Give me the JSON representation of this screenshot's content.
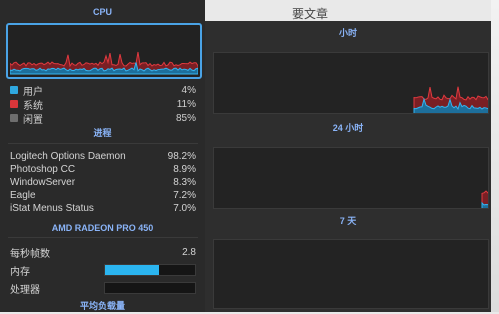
{
  "background": {
    "partial_text": "要文章"
  },
  "left_panel": {
    "cpu_title": "CPU",
    "legend": [
      {
        "label": "用户",
        "value": "4%",
        "color": "#2fa8e0",
        "icon": "user-swatch"
      },
      {
        "label": "系统",
        "value": "11%",
        "color": "#d8363a",
        "icon": "system-swatch"
      },
      {
        "label": "闲置",
        "value": "85%",
        "color": "#6e6e6e",
        "icon": "idle-swatch"
      }
    ],
    "processes_title": "进程",
    "processes": [
      {
        "name": "Logitech Options Daemon",
        "value": "98.2%"
      },
      {
        "name": "Photoshop CC",
        "value": "8.9%"
      },
      {
        "name": "WindowServer",
        "value": "8.3%"
      },
      {
        "name": "Eagle",
        "value": "7.2%"
      },
      {
        "name": "iStat Menus Status",
        "value": "7.0%"
      }
    ],
    "gpu_title": "AMD RADEON PRO 450",
    "gpu_rows": [
      {
        "label": "每秒帧数",
        "value": "2.8"
      },
      {
        "label": "内存",
        "fill_fraction": 0.6
      },
      {
        "label": "处理器",
        "fill_fraction": 0.0
      }
    ],
    "load_title": "平均负载量"
  },
  "right_panel": {
    "hour_title": "小时",
    "day_title": "24 小时",
    "week_title": "7 天"
  }
}
